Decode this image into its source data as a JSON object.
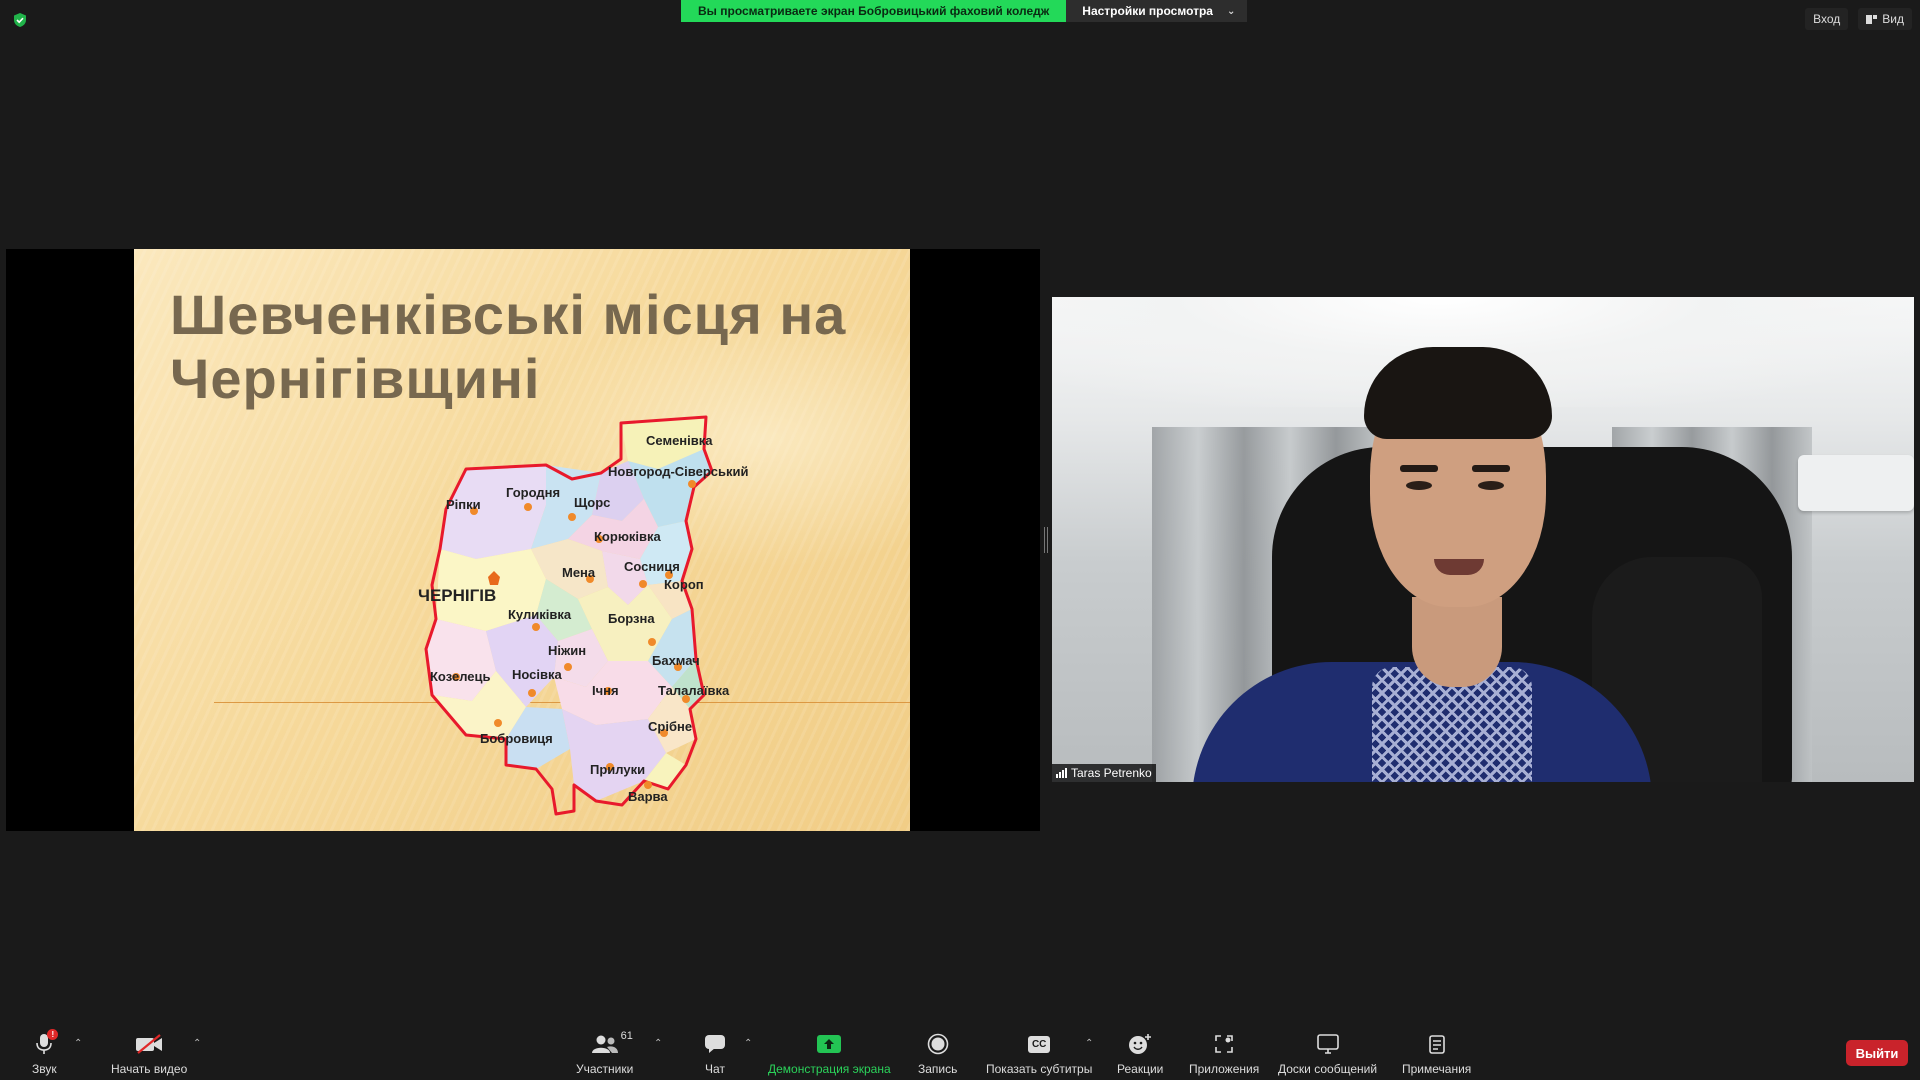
{
  "top_bar": {
    "share_notice": "Вы просматриваете экран Бобровицький фаховий коледж",
    "view_settings": "Настройки просмотра",
    "sign_in": "Вход",
    "view": "Вид"
  },
  "slide": {
    "title_line1": "Шевченківські місця на",
    "title_line2": "Чернігівщині",
    "map_labels": {
      "semenivka": "Семенівка",
      "novgorod": "Новгород-Сіверський",
      "ripky": "Ріпки",
      "horodnia": "Городня",
      "shchors": "Щорс",
      "koriukivka": "Корюківка",
      "mena": "Мена",
      "sosnytsia": "Сосниця",
      "korop": "Короп",
      "chernihiv": "ЧЕРНІГІВ",
      "kulykivka": "Куликівка",
      "borzna": "Борзна",
      "nizhyn": "Ніжин",
      "bakhmach": "Бахмач",
      "kozelets": "Козелець",
      "nosivka": "Носівка",
      "ichnia": "Ічня",
      "talalaivka": "Талалаївка",
      "sribne": "Срібне",
      "bobrovytsia": "Бобровиця",
      "pryluky": "Прилуки",
      "varva": "Варва"
    }
  },
  "participant": {
    "name": "Taras Petrenko"
  },
  "toolbar": {
    "audio": "Звук",
    "audio_badge": "!",
    "video": "Начать видео",
    "participants": "Участники",
    "participants_count": "61",
    "chat": "Чат",
    "share_screen": "Демонстрация экрана",
    "record": "Запись",
    "captions": "Показать субтитры",
    "captions_icon_text": "CC",
    "reactions": "Реакции",
    "apps": "Приложения",
    "whiteboards": "Доски сообщений",
    "notes": "Примечания",
    "leave": "Выйти"
  },
  "colors": {
    "share_green": "#23d959",
    "leave_red": "#c9232b",
    "map_border": "#e8192c",
    "title_brown": "#77684f"
  },
  "icons": {
    "shield": "shield-check-icon",
    "mic": "microphone-icon",
    "camera_off": "video-off-icon",
    "people": "participants-icon",
    "chat": "chat-bubble-icon",
    "share": "share-screen-arrow-icon",
    "record": "record-circle-icon",
    "captions": "cc-icon",
    "reactions": "smiley-plus-icon",
    "apps": "apps-icon",
    "whiteboard": "whiteboard-icon",
    "notes": "notes-icon"
  }
}
